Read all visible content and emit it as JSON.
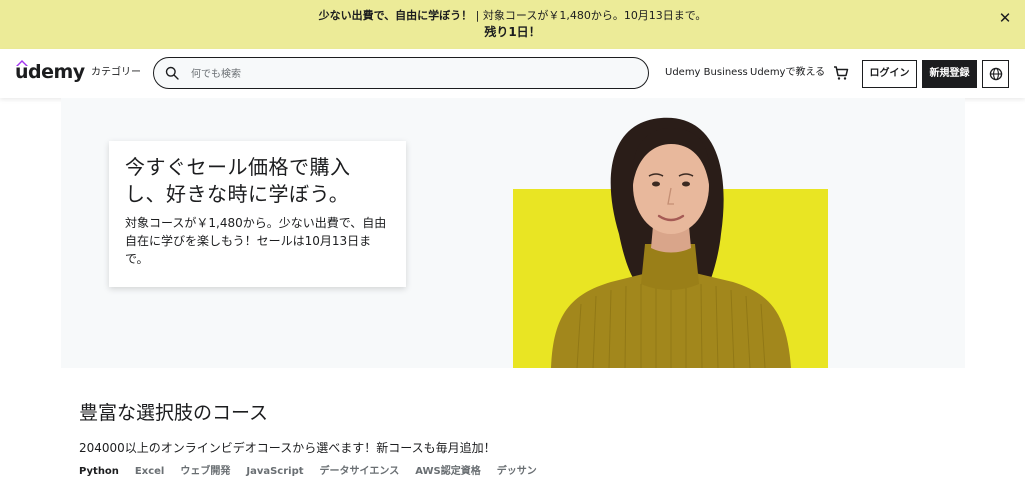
{
  "promo": {
    "bold_text": "少ない出費で、自由に学ぼう！",
    "detail_text": "| 対象コースが￥1,480から。10月13日まで。",
    "countdown": "残り1日！",
    "close_glyph": "✕"
  },
  "header": {
    "logo": "udemy",
    "categories_label": "カテゴリー",
    "search_placeholder": "何でも検索",
    "search_value": "",
    "business_link": "Udemy Business",
    "teach_link": "Udemyで教える",
    "cart_icon": "cart-icon",
    "login_label": "ログイン",
    "signup_label": "新規登録",
    "language_icon": "globe-icon"
  },
  "hero": {
    "title": "今すぐセール価格で購入し、好きな時に学ぼう。",
    "subtitle": "対象コースが￥1,480から。少ない出費で、自由自在に学びを楽しもう！セールは10月13日まで。",
    "accent_color": "#e9e523"
  },
  "courses": {
    "heading": "豊富な選択肢のコース",
    "subheading": "204000以上のオンラインビデオコースから選べます！新コースも毎月追加！",
    "tabs": [
      {
        "label": "Python",
        "active": true
      },
      {
        "label": "Excel",
        "active": false
      },
      {
        "label": "ウェブ開発",
        "active": false
      },
      {
        "label": "JavaScript",
        "active": false
      },
      {
        "label": "データサイエンス",
        "active": false
      },
      {
        "label": "AWS認定資格",
        "active": false
      },
      {
        "label": "デッサン",
        "active": false
      }
    ]
  },
  "colors": {
    "promo_bg": "#eceb98",
    "text": "#1c1d1f",
    "logo_accent": "#a435f0"
  }
}
